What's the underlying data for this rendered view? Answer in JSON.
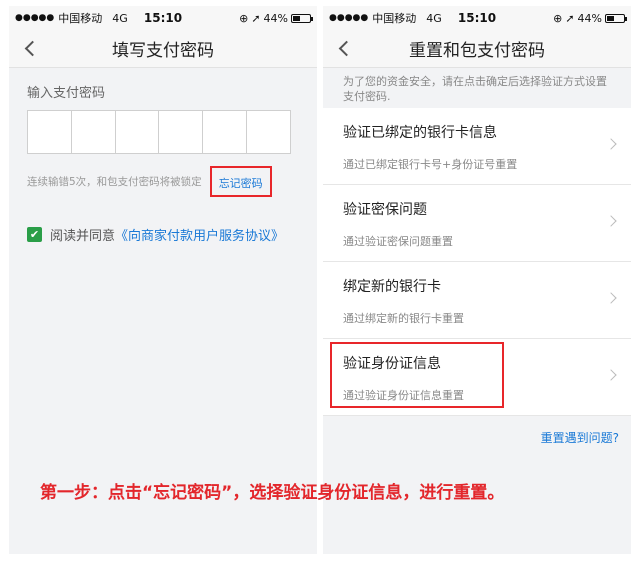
{
  "colors": {
    "accent_red": "#e8262a",
    "link_blue": "#1a79d6",
    "check_green": "#2a9e48"
  },
  "left_screen": {
    "status": {
      "carrier": "中国移动",
      "network": "4G",
      "time": "15:10",
      "battery": "44%"
    },
    "title": "填写支付密码",
    "password_label": "输入支付密码",
    "error_hint": "连续输错5次，和包支付密码将被锁定",
    "forgot_link": "忘记密码",
    "agree_prefix": "阅读并同意",
    "agree_link": "《向商家付款用户服务协议》"
  },
  "right_screen": {
    "status": {
      "carrier": "中国移动",
      "network": "4G",
      "time": "15:10",
      "battery": "44%"
    },
    "title": "重置和包支付密码",
    "notice": "为了您的资金安全，请在点击确定后选择验证方式设置支付密码.",
    "options": [
      {
        "title": "验证已绑定的银行卡信息",
        "subtitle": "通过已绑定银行卡号+身份证号重置"
      },
      {
        "title": "验证密保问题",
        "subtitle": "通过验证密保问题重置"
      },
      {
        "title": "绑定新的银行卡",
        "subtitle": "通过绑定新的银行卡重置"
      },
      {
        "title": "验证身份证信息",
        "subtitle": "通过验证身份证信息重置"
      }
    ],
    "trouble_link": "重置遇到问题?"
  },
  "caption": "第一步：点击“忘记密码”，选择验证身份证信息，进行重置。"
}
